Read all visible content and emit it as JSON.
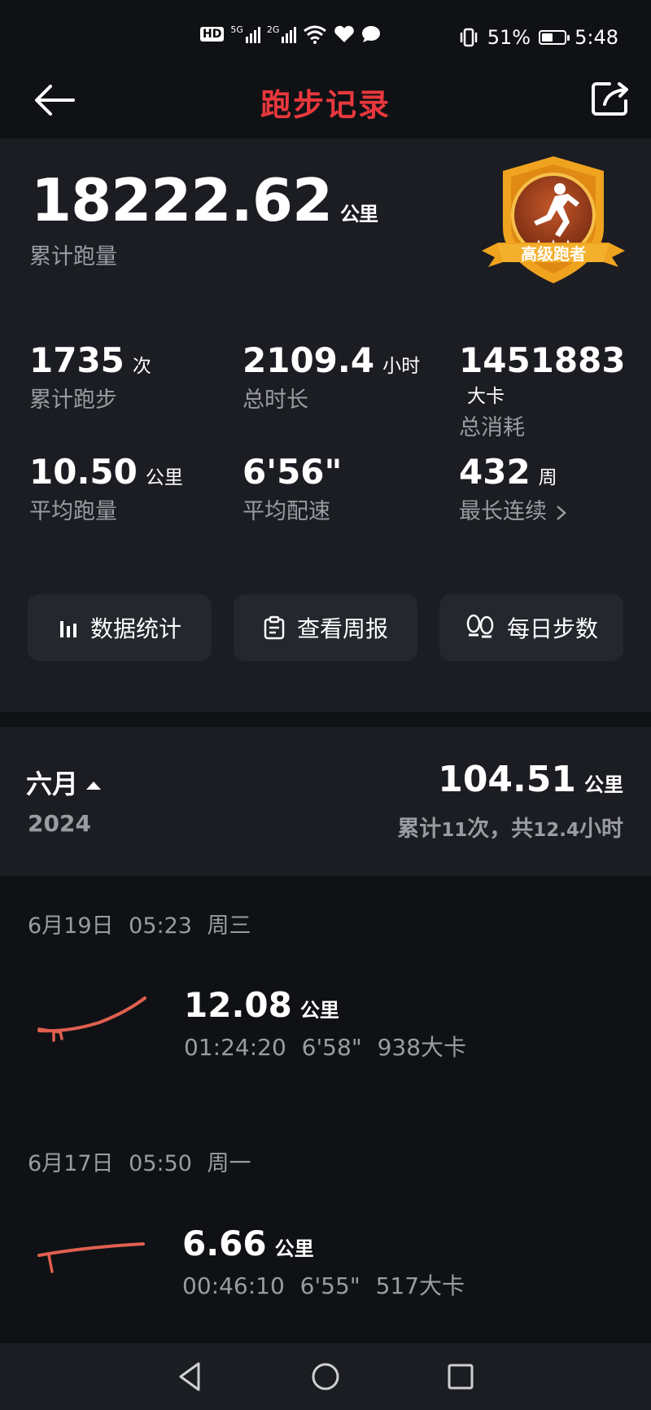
{
  "status_bar": {
    "hd": "HD",
    "net1": "5G",
    "net2": "2G",
    "battery_percent": "51%",
    "battery_level": 0.51,
    "time": "5:48"
  },
  "header": {
    "title": "跑步记录",
    "back_icon": "arrow-left-icon",
    "share_icon": "share-icon"
  },
  "summary": {
    "total_distance": "18222.62",
    "total_unit": "公里",
    "total_label": "累计跑量",
    "badge_text": "高级跑者",
    "stats": [
      {
        "value": "1735",
        "unit": "次",
        "label": "累计跑步"
      },
      {
        "value": "2109.4",
        "unit": "小时",
        "label": "总时长"
      },
      {
        "value": "1451883",
        "unit": "大卡",
        "label": "总消耗"
      },
      {
        "value": "10.50",
        "unit": "公里",
        "label": "平均跑量"
      },
      {
        "value": "6'56\"",
        "unit": "",
        "label": "平均配速"
      },
      {
        "value": "432",
        "unit": "周",
        "label": "最长连续",
        "has_arrow": true
      }
    ],
    "buttons": [
      {
        "label": "数据统计",
        "icon": "bar-chart-icon"
      },
      {
        "label": "查看周报",
        "icon": "clipboard-icon"
      },
      {
        "label": "每日步数",
        "icon": "footprints-icon"
      }
    ]
  },
  "month": {
    "name": "六月",
    "year": "2024",
    "distance": "104.51",
    "unit": "公里",
    "summary_prefix": "累计",
    "runs": "11",
    "summary_mid": "次，共",
    "hours": "12.4",
    "summary_suffix": "小时"
  },
  "runs": [
    {
      "date": "6月19日",
      "time": "05:23",
      "weekday": "周三",
      "distance": "12.08",
      "unit": "公里",
      "duration": "01:24:20",
      "pace": "6'58\"",
      "calories": "938大卡"
    },
    {
      "date": "6月17日",
      "time": "05:50",
      "weekday": "周一",
      "distance": "6.66",
      "unit": "公里",
      "duration": "00:46:10",
      "pace": "6'55\"",
      "calories": "517大卡"
    }
  ],
  "nav": {
    "back": "triangle-back-icon",
    "home": "circle-home-icon",
    "recent": "square-recent-icon"
  },
  "colors": {
    "accent": "#e8383d",
    "route": "#e0604f",
    "badge": "#f0a31f"
  }
}
